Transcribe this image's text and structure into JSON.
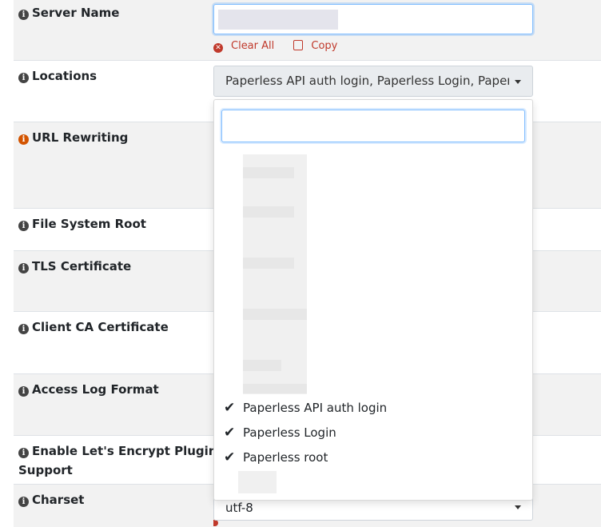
{
  "fields": {
    "server_name": {
      "label": "Server Name",
      "actions": {
        "clear_all": "Clear All",
        "copy": "Copy"
      }
    },
    "locations": {
      "label": "Locations",
      "selected_text": "Paperless API auth login, Paperless Login, Paperless"
    },
    "url_rewriting": {
      "label": "URL Rewriting"
    },
    "file_system_root": {
      "label": "File System Root"
    },
    "tls_certificate": {
      "label": "TLS Certificate"
    },
    "client_ca_certificate": {
      "label": "Client CA Certificate"
    },
    "access_log_format": {
      "label": "Access Log Format"
    },
    "lets_encrypt": {
      "label_line1": "Enable Let's Encrypt Plugin",
      "label_line2": "Support"
    },
    "charset": {
      "label": "Charset",
      "value": "utf-8"
    }
  },
  "dropdown": {
    "search_value": "",
    "checked_items": [
      {
        "label": "Paperless API auth login",
        "checked": true
      },
      {
        "label": "Paperless Login",
        "checked": true
      },
      {
        "label": "Paperless root",
        "checked": true
      }
    ]
  },
  "icons": {
    "info": "info-circle-icon",
    "clear": "times-circle-icon",
    "copy": "copy-icon",
    "check": "check-icon",
    "caret": "caret-down-icon"
  },
  "colors": {
    "row_shade": "#f2f2f2",
    "warning_icon": "#d35400",
    "danger_text": "#c0392b",
    "focus_border": "#80bdff"
  }
}
